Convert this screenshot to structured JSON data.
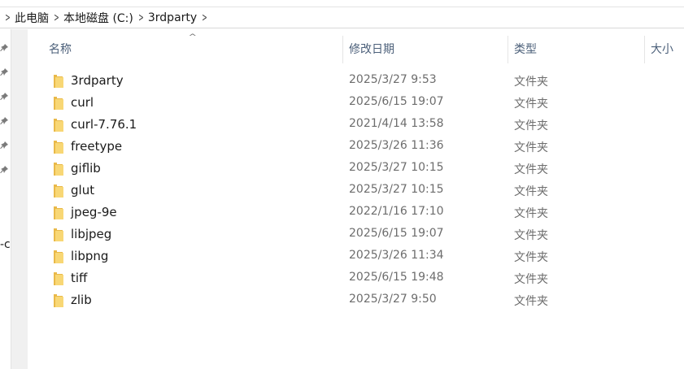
{
  "breadcrumb": {
    "items": [
      "此电脑",
      "本地磁盘 (C:)",
      "3rdparty"
    ]
  },
  "nav": {
    "cutoff_text": "-c"
  },
  "columns": {
    "name": "名称",
    "date": "修改日期",
    "type": "类型",
    "size": "大小"
  },
  "files": [
    {
      "name": "3rdparty",
      "date": "2025/3/27 9:53",
      "type": "文件夹"
    },
    {
      "name": "curl",
      "date": "2025/6/15 19:07",
      "type": "文件夹"
    },
    {
      "name": "curl-7.76.1",
      "date": "2021/4/14 13:58",
      "type": "文件夹"
    },
    {
      "name": "freetype",
      "date": "2025/3/26 11:36",
      "type": "文件夹"
    },
    {
      "name": "giflib",
      "date": "2025/3/27 10:15",
      "type": "文件夹"
    },
    {
      "name": "glut",
      "date": "2025/3/27 10:15",
      "type": "文件夹"
    },
    {
      "name": "jpeg-9e",
      "date": "2022/1/16 17:10",
      "type": "文件夹"
    },
    {
      "name": "libjpeg",
      "date": "2025/6/15 19:07",
      "type": "文件夹"
    },
    {
      "name": "libpng",
      "date": "2025/3/26 11:34",
      "type": "文件夹"
    },
    {
      "name": "tiff",
      "date": "2025/6/15 19:48",
      "type": "文件夹"
    },
    {
      "name": "zlib",
      "date": "2025/3/27 9:50",
      "type": "文件夹"
    }
  ],
  "icons": {
    "folder": "folder-icon",
    "pin": "pin-icon",
    "sort": "sort-ascending-icon",
    "chevron": "chevron-right-icon"
  },
  "colors": {
    "header_text": "#4c607a",
    "meta_text": "#6d6d6d",
    "folder_yellow": "#f8d775"
  }
}
